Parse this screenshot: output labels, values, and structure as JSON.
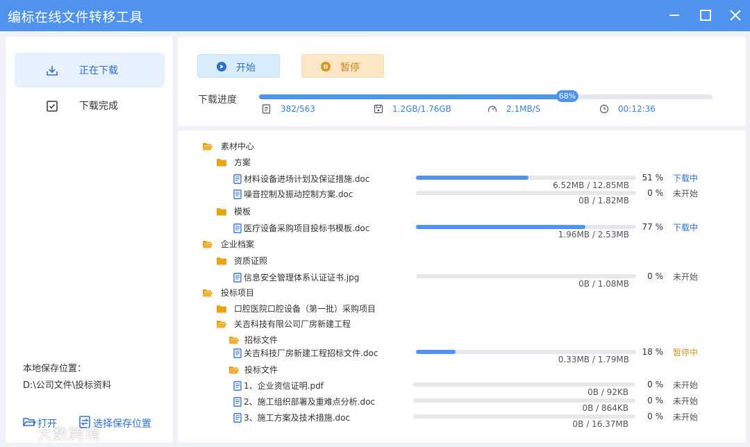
{
  "app": {
    "title": "编标在线文件转移工具"
  },
  "window_controls": {
    "minimize_icon": "minimize-icon",
    "maximize_icon": "maximize-icon",
    "close_icon": "close-icon"
  },
  "sidebar": {
    "items": [
      {
        "label": "正在下载",
        "icon": "download-icon",
        "active": true
      },
      {
        "label": "下载完成",
        "icon": "checkbox-icon",
        "active": false
      }
    ],
    "save_location_label": "本地保存位置：",
    "save_location_path": "D:\\公司文件\\投标资料",
    "open_label": "打开",
    "choose_location_label": "选择保存位置"
  },
  "controls": {
    "start_label": "开始",
    "pause_label": "暂停",
    "progress_label": "下载进度",
    "progress_percent": 68,
    "progress_text": "68%",
    "stats": {
      "files": "382/563",
      "size": "1.2GB/1.76GB",
      "speed": "2.1MB/S",
      "time": "00:12:36"
    }
  },
  "colors": {
    "accent": "#4f93ee",
    "link": "#2b6fd6",
    "paused": "#d9951f",
    "folder": "#e8a317"
  },
  "tree": [
    {
      "type": "folder-open",
      "depth": 0,
      "name": "素材中心"
    },
    {
      "type": "folder",
      "depth": 1,
      "name": "方案"
    },
    {
      "type": "file",
      "depth": 2,
      "name": "材料设备进场计划及保证措施.doc",
      "size": "6.52MB / 12.85MB",
      "percent": 51,
      "pct_text": "51 %",
      "status": "下载中",
      "status_kind": "downloading"
    },
    {
      "type": "file",
      "depth": 2,
      "name": "噪音控制及振动控制方案.doc",
      "size": "0B / 1.82MB",
      "percent": 0,
      "pct_text": "0 %",
      "status": "未开始",
      "status_kind": "pending"
    },
    {
      "type": "folder",
      "depth": 1,
      "name": "模板"
    },
    {
      "type": "file",
      "depth": 2,
      "name": "医疗设备采购项目投标书模板.doc",
      "size": "1.96MB / 2.53MB",
      "percent": 77,
      "pct_text": "77 %",
      "status": "下载中",
      "status_kind": "downloading"
    },
    {
      "type": "folder-open",
      "depth": 0,
      "name": "企业档案"
    },
    {
      "type": "folder",
      "depth": 1,
      "name": "资质证照"
    },
    {
      "type": "file",
      "depth": 2,
      "name": "信息安全管理体系认证证书.jpg",
      "size": "0B / 1.08MB",
      "percent": 0,
      "pct_text": "0 %",
      "status": "未开始",
      "status_kind": "pending"
    },
    {
      "type": "folder-open",
      "depth": 0,
      "name": "投标项目"
    },
    {
      "type": "folder",
      "depth": 1,
      "name": "口腔医院口腔设备（第一批）采购项目"
    },
    {
      "type": "folder-open",
      "depth": 1,
      "name": "关吉科技有限公司厂房新建工程"
    },
    {
      "type": "folder-open",
      "depth": 2,
      "name": "招标文件"
    },
    {
      "type": "file",
      "depth": 2,
      "name": "关吉科技厂房新建工程招标文件.doc",
      "size": "0.33MB / 1.79MB",
      "percent": 18,
      "pct_text": "18 %",
      "status": "暂停中",
      "status_kind": "paused"
    },
    {
      "type": "folder-open",
      "depth": 2,
      "name": "投标文件"
    },
    {
      "type": "file",
      "depth": 2,
      "name": "1、企业资信证明.pdf",
      "size": "0B / 92KB",
      "percent": 0,
      "pct_text": "0 %",
      "status": "未开始",
      "status_kind": "pending"
    },
    {
      "type": "file",
      "depth": 2,
      "name": "2、施工组织部署及重难点分析.doc",
      "size": "0B / 864KB",
      "percent": 0,
      "pct_text": "0 %",
      "status": "未开始",
      "status_kind": "pending"
    },
    {
      "type": "file",
      "depth": 2,
      "name": "3、施工方案及技术措施.doc",
      "size": "0B / 16.37MB",
      "percent": 0,
      "pct_text": "0 %",
      "status": "未开始",
      "status_kind": "pending"
    }
  ],
  "watermark": {
    "text": "大数跨境"
  }
}
